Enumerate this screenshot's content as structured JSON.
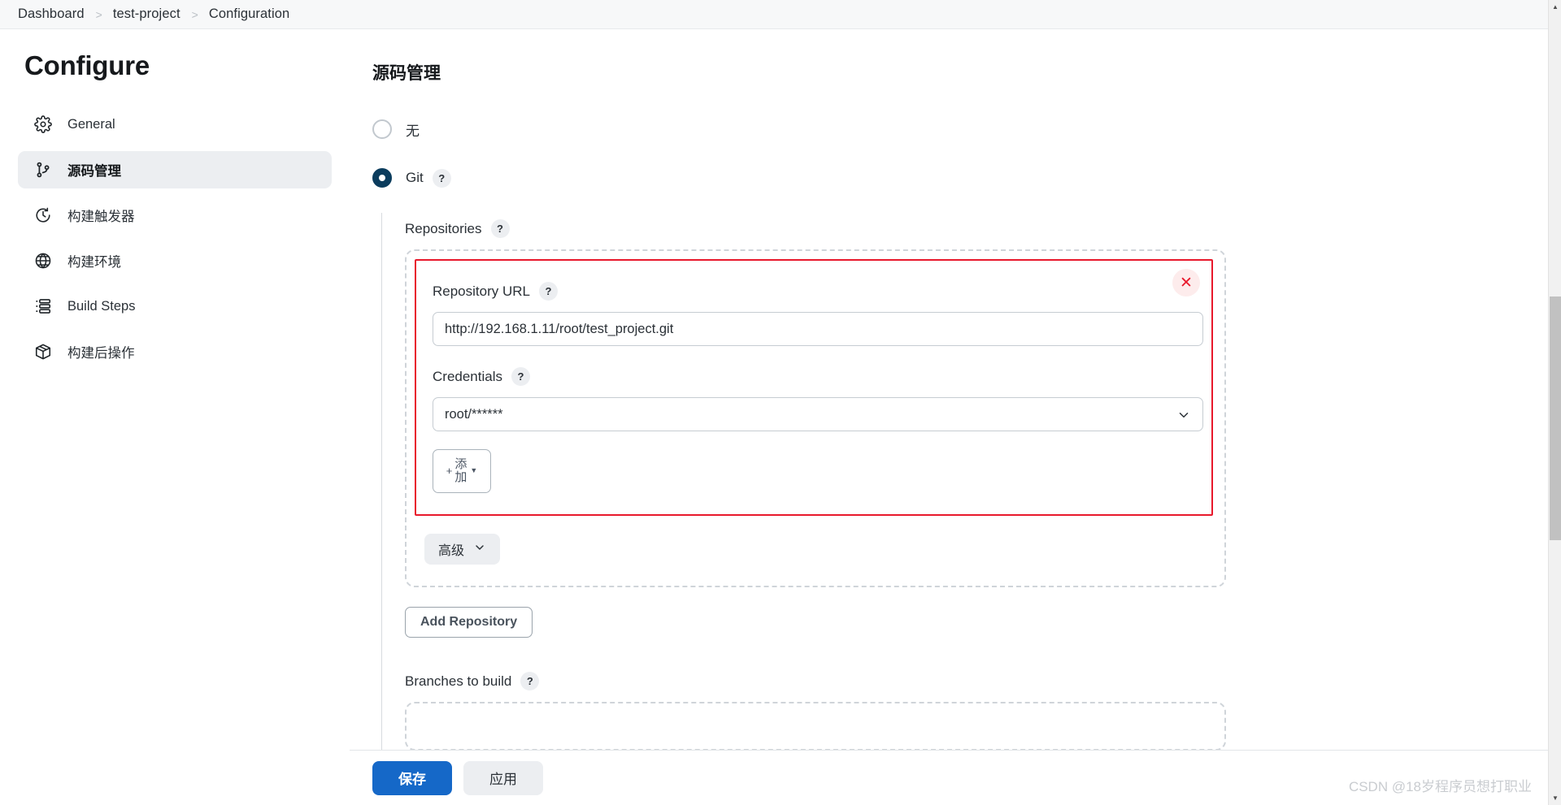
{
  "breadcrumb": {
    "items": [
      "Dashboard",
      "test-project",
      "Configuration"
    ],
    "separator": ">"
  },
  "sidebar": {
    "title": "Configure",
    "items": [
      {
        "label": "General",
        "icon": "gear-icon",
        "active": false
      },
      {
        "label": "源码管理",
        "icon": "source-branch-icon",
        "active": true
      },
      {
        "label": "构建触发器",
        "icon": "clock-icon",
        "active": false
      },
      {
        "label": "构建环境",
        "icon": "globe-icon",
        "active": false
      },
      {
        "label": "Build Steps",
        "icon": "list-steps-icon",
        "active": false
      },
      {
        "label": "构建后操作",
        "icon": "package-box-icon",
        "active": false
      }
    ]
  },
  "main": {
    "section_title": "源码管理",
    "scm_options": [
      {
        "label": "无",
        "selected": false
      },
      {
        "label": "Git",
        "selected": true,
        "help": "?"
      }
    ],
    "repositories": {
      "label": "Repositories",
      "help": "?",
      "repo": {
        "url_label": "Repository URL",
        "url_help": "?",
        "url_value": "http://192.168.1.11/root/test_project.git",
        "credentials_label": "Credentials",
        "credentials_help": "?",
        "credentials_value": "root/******",
        "add_button": {
          "plus": "+",
          "label": "添加",
          "caret": "▼"
        },
        "delete_icon": "close-icon"
      },
      "advanced_button": {
        "label": "高级",
        "caret": "⌄"
      },
      "add_repository_button": "Add Repository"
    },
    "branches": {
      "label": "Branches to build",
      "help": "?"
    }
  },
  "footer": {
    "save_label": "保存",
    "apply_label": "应用"
  },
  "watermark": "CSDN @18岁程序员想打职业",
  "colors": {
    "primary_button": "#1568c8",
    "radio_selected": "#0b3c5d",
    "error_border": "#e8192c",
    "active_nav_bg": "#eceef1"
  }
}
